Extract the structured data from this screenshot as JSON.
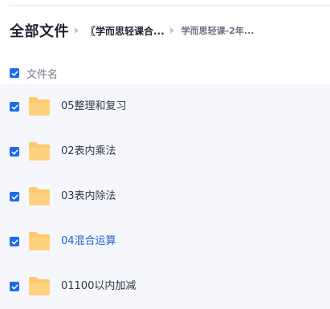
{
  "breadcrumb": {
    "root": "全部文件",
    "level2": "〖学而思轻课合...",
    "level3": "学而思轻课-2年..."
  },
  "list_header": {
    "select_all_checked": true,
    "column_label": "文件名"
  },
  "files": [
    {
      "name": "05整理和复习",
      "checked": true,
      "highlighted": false,
      "icon": "folder-icon"
    },
    {
      "name": "02表内乘法",
      "checked": true,
      "highlighted": false,
      "icon": "folder-icon"
    },
    {
      "name": "03表内除法",
      "checked": true,
      "highlighted": false,
      "icon": "folder-icon"
    },
    {
      "name": "04混合运算",
      "checked": true,
      "highlighted": true,
      "icon": "folder-icon"
    },
    {
      "name": "01100以内加减",
      "checked": true,
      "highlighted": false,
      "icon": "folder-icon"
    }
  ],
  "colors": {
    "accent": "#1c6be9",
    "folder": "#ffc96b",
    "highlight_text": "#1b5fd6",
    "list_background": "#f6f7fc"
  }
}
